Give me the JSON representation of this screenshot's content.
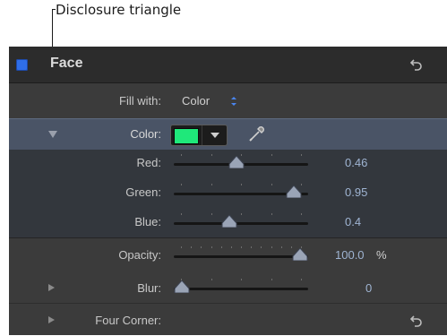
{
  "callout": {
    "text": "Disclosure triangle"
  },
  "header": {
    "title": "Face"
  },
  "fill_with": {
    "label": "Fill with:",
    "value": "Color"
  },
  "color": {
    "label": "Color:",
    "swatch": "#1fe87a"
  },
  "red": {
    "label": "Red:",
    "value": "0.46",
    "level": 0.46
  },
  "green": {
    "label": "Green:",
    "value": "0.95",
    "level": 0.95
  },
  "blue": {
    "label": "Blue:",
    "value": "0.4",
    "level": 0.4
  },
  "opacity": {
    "label": "Opacity:",
    "value": "100.0",
    "unit": "%",
    "level": 1.0
  },
  "blur": {
    "label": "Blur:",
    "value": "0",
    "level": 0
  },
  "four_corner": {
    "label": "Four Corner:"
  },
  "colors": {
    "accent": "#2f6ee8",
    "value_text": "#9fb4d2",
    "panel_bg": "#3b3b3b"
  }
}
